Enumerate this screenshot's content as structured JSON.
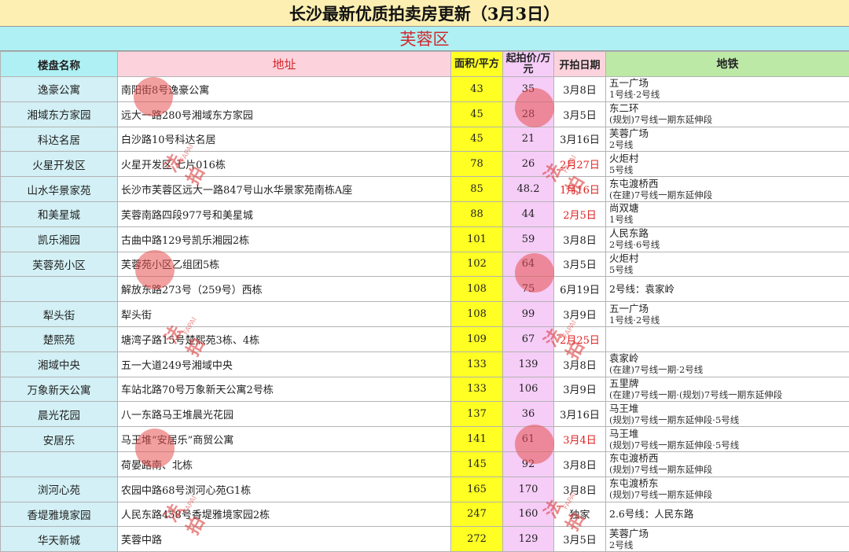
{
  "title": "长沙最新优质拍卖房更新（3月3日）",
  "district": "芙蓉区",
  "headers": {
    "name": "楼盘名称",
    "address": "地址",
    "area": "面积/平方",
    "price": "起拍价/万元",
    "date": "开拍日期",
    "metro": "地铁"
  },
  "watermark": {
    "text": "法拍",
    "latin": "FAPAI",
    "color": "#e05050"
  },
  "colors": {
    "title_bg": "#fcefb1",
    "district_bg": "#aef0f3",
    "name_bg": "#d2f0f5",
    "area_bg": "#ffff24",
    "price_bg": "#f5cdf7",
    "accent_red": "#d3282e"
  },
  "rows": [
    {
      "name": "逸豪公寓",
      "address": "南阳街8号逸豪公寓",
      "area": "43",
      "price": "35",
      "date": "3月8日",
      "date_red": false,
      "metro": "五一广场",
      "metro_sub": "1号线·2号线"
    },
    {
      "name": "湘域东方家园",
      "address": "远大一路280号湘域东方家园",
      "area": "45",
      "price": "28",
      "date": "3月5日",
      "date_red": false,
      "metro": "东二环",
      "metro_sub": "(规划)7号线一期东延伸段"
    },
    {
      "name": "科达名居",
      "address": "白沙路10号科达名居",
      "area": "45",
      "price": "21",
      "date": "3月16日",
      "date_red": false,
      "metro": "芙蓉广场",
      "metro_sub": "2号线"
    },
    {
      "name": "火星开发区",
      "address": "火星开发区 七片016栋",
      "area": "78",
      "price": "26",
      "date": "2月27日",
      "date_red": true,
      "metro": "火炬村",
      "metro_sub": "5号线"
    },
    {
      "name": "山水华景家苑",
      "address": "长沙市芙蓉区远大一路847号山水华景家苑南栋A座",
      "area": "85",
      "price": "48.2",
      "date": "1月16日",
      "date_red": true,
      "metro": "东屯渡桥西",
      "metro_sub": "(在建)7号线一期东延伸段"
    },
    {
      "name": "和美星城",
      "address": "芙蓉南路四段977号和美星城",
      "area": "88",
      "price": "44",
      "date": "2月5日",
      "date_red": true,
      "metro": "尚双塘",
      "metro_sub": "1号线"
    },
    {
      "name": "凯乐湘园",
      "address": "古曲中路129号凯乐湘园2栋",
      "area": "101",
      "price": "59",
      "date": "3月8日",
      "date_red": false,
      "metro": "人民东路",
      "metro_sub": "2号线·6号线"
    },
    {
      "name": "芙蓉苑小区",
      "address": "芙蓉苑小区乙组团5栋",
      "area": "102",
      "price": "64",
      "date": "3月5日",
      "date_red": false,
      "metro": "火炬村",
      "metro_sub": "5号线"
    },
    {
      "name": "",
      "address": "解放东路273号（259号）西栋",
      "area": "108",
      "price": "75",
      "date": "6月19日",
      "date_red": false,
      "metro": "2号线：袁家岭",
      "metro_sub": ""
    },
    {
      "name": "犁头街",
      "address": "犁头街",
      "area": "108",
      "price": "99",
      "date": "3月9日",
      "date_red": false,
      "metro": "五一广场",
      "metro_sub": "1号线·2号线"
    },
    {
      "name": "楚熙苑",
      "address": "塘湾子路15号楚熙苑3栋、4栋",
      "area": "109",
      "price": "67",
      "date": "2月25日",
      "date_red": true,
      "metro": "",
      "metro_sub": ""
    },
    {
      "name": "湘域中央",
      "address": "五一大道249号湘域中央",
      "area": "133",
      "price": "139",
      "date": "3月8日",
      "date_red": false,
      "metro": "袁家岭",
      "metro_sub": "(在建)7号线一期·2号线"
    },
    {
      "name": "万象新天公寓",
      "address": "车站北路70号万象新天公寓2号栋",
      "area": "133",
      "price": "106",
      "date": "3月9日",
      "date_red": false,
      "metro": "五里牌",
      "metro_sub": "(在建)7号线一期·(规划)7号线一期东延伸段"
    },
    {
      "name": "晨光花园",
      "address": "八一东路马王堆晨光花园",
      "area": "137",
      "price": "36",
      "date": "3月16日",
      "date_red": false,
      "metro": "马王堆",
      "metro_sub": "(规划)7号线一期东延伸段·5号线"
    },
    {
      "name": "安居乐",
      "address": "马王堆“安居乐”商贸公寓",
      "area": "141",
      "price": "61",
      "date": "3月4日",
      "date_red": true,
      "metro": "马王堆",
      "metro_sub": "(规划)7号线一期东延伸段·5号线"
    },
    {
      "name": "",
      "address": "荷晏路南、北栋",
      "area": "145",
      "price": "92",
      "date": "3月8日",
      "date_red": false,
      "metro": "东屯渡桥西",
      "metro_sub": "(规划)7号线一期东延伸段"
    },
    {
      "name": "浏河心苑",
      "address": "农园中路68号浏河心苑G1栋",
      "area": "165",
      "price": "170",
      "date": "3月8日",
      "date_red": false,
      "metro": "东屯渡桥东",
      "metro_sub": "(规划)7号线一期东延伸段"
    },
    {
      "name": "香堤雅境家园",
      "address": "人民东路458号香堤雅境家园2栋",
      "area": "247",
      "price": "160",
      "date": "独家",
      "date_red": false,
      "metro": "2.6号线：人民东路",
      "metro_sub": ""
    },
    {
      "name": "华天新城",
      "address": "芙蓉中路",
      "area": "272",
      "price": "129",
      "date": "3月5日",
      "date_red": false,
      "metro": "芙蓉广场",
      "metro_sub": "2号线"
    }
  ]
}
